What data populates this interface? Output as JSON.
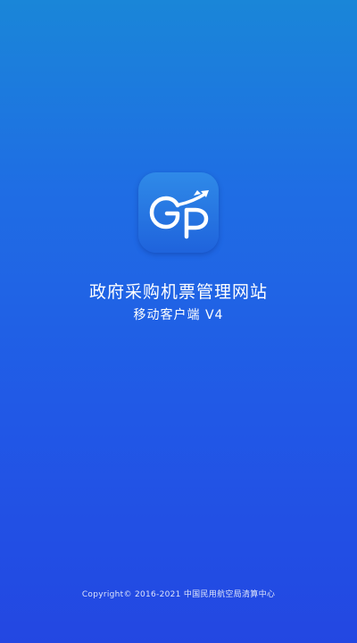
{
  "app": {
    "logo_text": "GP",
    "title": "政府采购机票管理网站",
    "subtitle": "移动客户端 V4"
  },
  "footer": {
    "copyright": "Copyright© 2016-2021 中国民用航空局清算中心"
  },
  "colors": {
    "background_top": "#1a86d8",
    "background_bottom": "#2347e2",
    "icon_top": "#2f8ae8",
    "icon_bottom": "#1f63dc",
    "text": "#ffffff"
  },
  "icons": {
    "app_icon": "gp-plane-logo-icon"
  }
}
